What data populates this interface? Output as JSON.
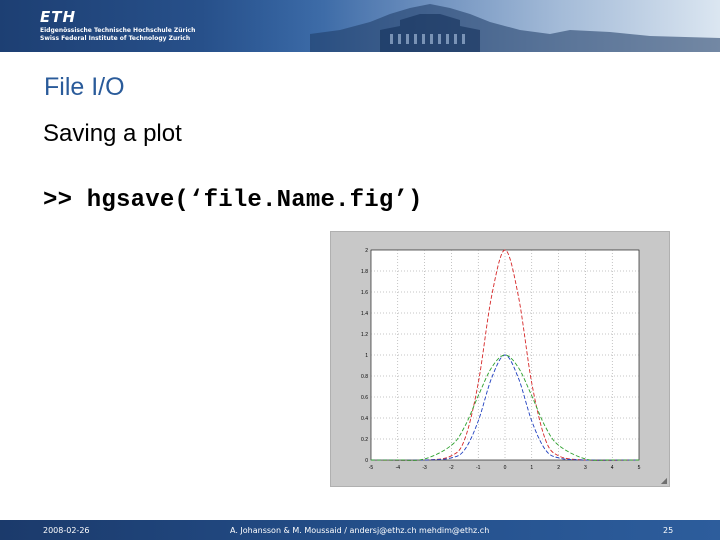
{
  "header": {
    "logo": "ETH",
    "institution_de": "Eidgenössische Technische Hochschule Zürich",
    "institution_en": "Swiss Federal Institute of Technology Zurich",
    "colors": {
      "banner_dark": "#1d3f73",
      "banner_light": "#dfe9f3"
    }
  },
  "slide": {
    "title": "File I/O",
    "subtitle": "Saving a plot",
    "code": ">> hgsave(‘file.Name.fig’)",
    "title_color": "#2a5b9a"
  },
  "figure": {
    "resize_grip_icon": "resize-grip-icon"
  },
  "chart_data": {
    "type": "line",
    "title": "",
    "xlabel": "",
    "ylabel": "",
    "xlim": [
      -5,
      5
    ],
    "ylim": [
      0,
      2
    ],
    "x_ticks": [
      "-5",
      "-4",
      "-3",
      "-2",
      "-1",
      "0",
      "1",
      "2",
      "3",
      "4",
      "5"
    ],
    "y_ticks": [
      "0",
      "0.2",
      "0.4",
      "0.6",
      "0.8",
      "1",
      "1.2",
      "1.4",
      "1.6",
      "1.8",
      "2"
    ],
    "grid": true,
    "series": [
      {
        "color": "#d62728",
        "dash": "4,2",
        "x": [
          -3,
          -2,
          -1.5,
          -1,
          -0.5,
          0,
          0.5,
          1,
          1.5,
          2,
          3
        ],
        "y": [
          0.0,
          0.04,
          0.2,
          0.73,
          1.56,
          2.0,
          1.56,
          0.73,
          0.2,
          0.04,
          0.0
        ]
      },
      {
        "color": "#1f3fbf",
        "dash": "4,2",
        "x": [
          -3,
          -2,
          -1.5,
          -1,
          -0.5,
          0,
          0.5,
          1,
          1.5,
          2,
          3
        ],
        "y": [
          0.0,
          0.02,
          0.1,
          0.37,
          0.78,
          1.0,
          0.78,
          0.37,
          0.1,
          0.02,
          0.0
        ]
      },
      {
        "color": "#2ca02c",
        "dash": "4,2",
        "x": [
          -4,
          -3,
          -2,
          -1.5,
          -1,
          -0.5,
          0,
          0.5,
          1,
          1.5,
          2,
          3,
          4
        ],
        "y": [
          0.0,
          0.01,
          0.14,
          0.32,
          0.61,
          0.88,
          1.0,
          0.88,
          0.61,
          0.32,
          0.14,
          0.01,
          0.0
        ]
      }
    ]
  },
  "footer": {
    "date": "2008-02-26",
    "authors": "A. Johansson & M. Moussaid / andersj@ethz.ch mehdim@ethz.ch",
    "page": "25"
  }
}
